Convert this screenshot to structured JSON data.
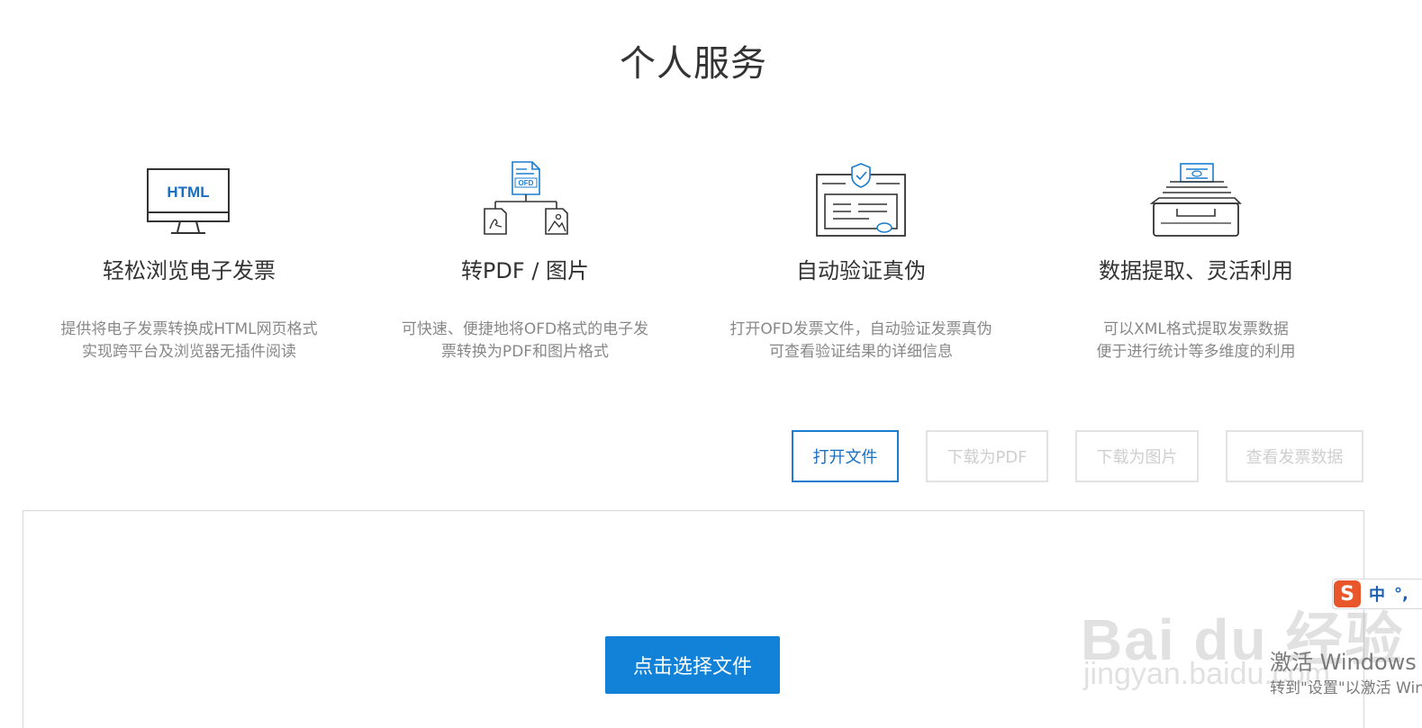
{
  "page": {
    "title": "个人服务"
  },
  "features": [
    {
      "icon": "html-monitor-icon",
      "icon_text": "HTML",
      "title": "轻松浏览电子发票",
      "desc_line1": "提供将电子发票转换成HTML网页格式",
      "desc_line2": "实现跨平台及浏览器无插件阅读"
    },
    {
      "icon": "ofd-convert-icon",
      "icon_text": "OFD",
      "title": "转PDF / 图片",
      "desc_line1": "可快速、便捷地将OFD格式的电子发",
      "desc_line2": "票转换为PDF和图片格式"
    },
    {
      "icon": "verify-shield-icon",
      "title": "自动验证真伪",
      "desc_line1": "打开OFD发票文件，自动验证发票真伪",
      "desc_line2": "可查看验证结果的详细信息"
    },
    {
      "icon": "data-drawer-icon",
      "title": "数据提取、灵活利用",
      "desc_line1": "可以XML格式提取发票数据",
      "desc_line2": "便于进行统计等多维度的利用"
    }
  ],
  "toolbar": {
    "open_file": "打开文件",
    "download_pdf": "下载为PDF",
    "download_image": "下载为图片",
    "view_invoice_data": "查看发票数据"
  },
  "viewer": {
    "select_file": "点击选择文件"
  },
  "ime": {
    "logo": "S",
    "mode": "中",
    "punct": "°,"
  },
  "watermark": {
    "brand": "Bai du 经验",
    "url": "jingyan.baidu.com"
  },
  "windows_notice": {
    "title": "激活 Windows",
    "subtitle": "转到\"设置\"以激活 Windows。"
  },
  "colors": {
    "primary": "#1182d8",
    "accent_blue": "#1a7dd0",
    "icon_stroke": "#333333",
    "disabled": "#cfcfcf"
  }
}
